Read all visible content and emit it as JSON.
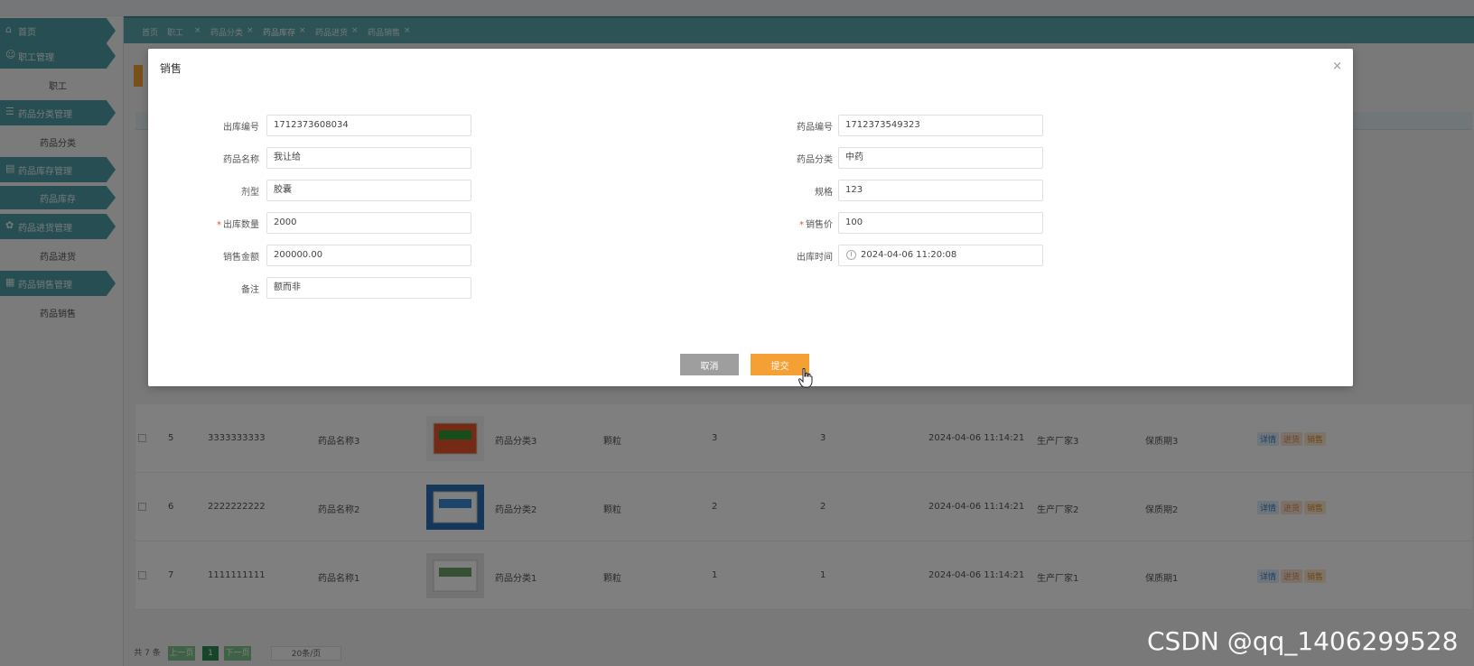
{
  "sidebar": {
    "home": "首页",
    "groups": [
      {
        "label": "职工管理",
        "icon": "user-icon",
        "items": [
          "职工"
        ]
      },
      {
        "label": "药品分类管理",
        "icon": "list-icon",
        "items": [
          "药品分类"
        ]
      },
      {
        "label": "药品库存管理",
        "icon": "box-icon",
        "items": [
          "药品库存"
        ]
      },
      {
        "label": "药品进货管理",
        "icon": "gear-icon",
        "items": [
          "药品进货"
        ]
      },
      {
        "label": "药品销售管理",
        "icon": "grid-icon",
        "items": [
          "药品销售"
        ]
      }
    ]
  },
  "tabs": [
    "首页",
    "职工",
    "药品分类",
    "药品库存",
    "药品进货",
    "药品销售"
  ],
  "table": {
    "rows": [
      {
        "idx": "5",
        "code": "3333333333",
        "name": "药品名称3",
        "category": "药品分类3",
        "form": "颗粒",
        "spec": "3",
        "qty": "3",
        "time": "2024-04-06 11:14:21",
        "maker": "生产厂家3",
        "shelf": "保质期3"
      },
      {
        "idx": "6",
        "code": "2222222222",
        "name": "药品名称2",
        "category": "药品分类2",
        "form": "颗粒",
        "spec": "2",
        "qty": "2",
        "time": "2024-04-06 11:14:21",
        "maker": "生产厂家2",
        "shelf": "保质期2"
      },
      {
        "idx": "7",
        "code": "1111111111",
        "name": "药品名称1",
        "category": "药品分类1",
        "form": "颗粒",
        "spec": "1",
        "qty": "1",
        "time": "2024-04-06 11:14:21",
        "maker": "生产厂家1",
        "shelf": "保质期1"
      }
    ],
    "ops": {
      "detail": "详情",
      "stock": "进货",
      "sell": "销售"
    }
  },
  "pager": {
    "total": "共 7 条",
    "prev": "上一页",
    "page": "1",
    "next": "下一页",
    "size": "20条/页"
  },
  "modal": {
    "title": "销售",
    "close": "×",
    "left_fields": [
      {
        "label": "出库编号",
        "value": "1712373608034",
        "required": false
      },
      {
        "label": "药品名称",
        "value": "我让给",
        "required": false
      },
      {
        "label": "剂型",
        "value": "胶囊",
        "required": false
      },
      {
        "label": "出库数量",
        "value": "2000",
        "required": true
      },
      {
        "label": "销售金额",
        "value": "200000.00",
        "required": false
      },
      {
        "label": "备注",
        "value": "额而非",
        "required": false
      }
    ],
    "right_fields": [
      {
        "label": "药品编号",
        "value": "1712373549323",
        "required": false
      },
      {
        "label": "药品分类",
        "value": "中药",
        "required": false
      },
      {
        "label": "规格",
        "value": "123",
        "required": false
      },
      {
        "label": "销售价",
        "value": "100",
        "required": true
      },
      {
        "label": "出库时间",
        "value": "2024-04-06 11:20:08",
        "required": false
      }
    ],
    "cancel": "取消",
    "submit": "提交"
  },
  "watermark": "CSDN @qq_1406299528"
}
